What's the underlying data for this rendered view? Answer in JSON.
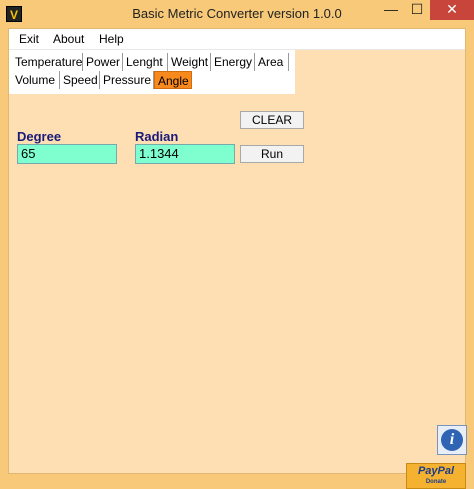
{
  "window": {
    "title": "Basic Metric Converter version 1.0.0",
    "icon_letter": "V",
    "controls": {
      "minimize": "—",
      "maximize": "☐",
      "close": "✕"
    }
  },
  "menu": {
    "items": [
      "Exit",
      "About",
      "Help"
    ]
  },
  "tabs": {
    "row1": [
      "Temperature",
      "Power",
      "Lenght",
      "Weight",
      "Energy",
      "Area"
    ],
    "row2": [
      "Volume",
      "Speed",
      "Pressure",
      "Angle"
    ],
    "active": "Angle"
  },
  "converter": {
    "from_label": "Degree",
    "from_value": "65",
    "to_label": "Radian",
    "to_value": "1.1344",
    "clear_label": "CLEAR",
    "run_label": "Run"
  },
  "side": {
    "info_glyph": "i",
    "paypal_label": "PayPal",
    "paypal_sub": "Donate"
  },
  "colors": {
    "accent": "#f8891d",
    "field": "#7fffd0",
    "background": "#fddfb3"
  }
}
